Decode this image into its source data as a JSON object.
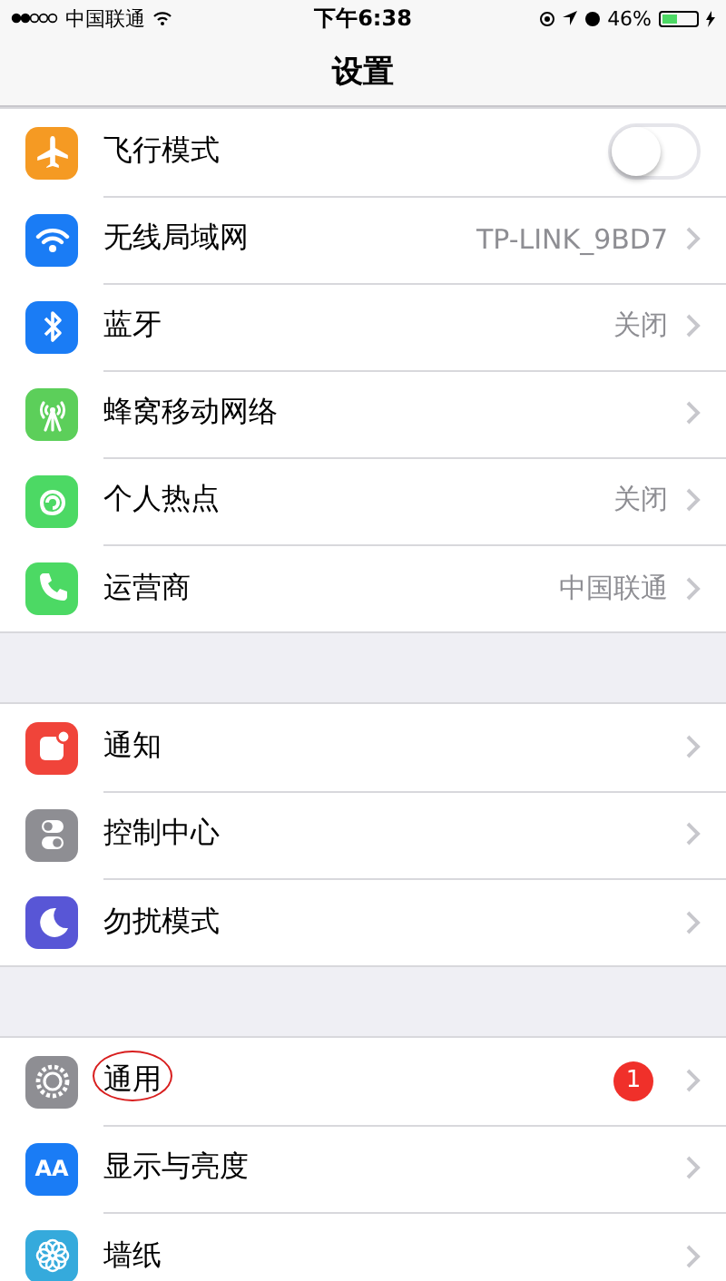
{
  "status_bar": {
    "carrier": "中国联通",
    "time": "下午6:38",
    "battery": {
      "text": "46%",
      "level": 0.46
    }
  },
  "nav": {
    "title": "设置"
  },
  "groups": [
    {
      "rows": [
        {
          "kind": "toggle",
          "label": "飞行模式",
          "on": false,
          "color": "#f59a23",
          "circled": false
        },
        {
          "kind": "link",
          "label": "无线局域网",
          "value": "TP-LINK_9BD7",
          "color": "#1a7cf5",
          "circled": false
        },
        {
          "kind": "link",
          "label": "蓝牙",
          "value": "关闭",
          "color": "#1a7cf5",
          "circled": false
        },
        {
          "kind": "link",
          "label": "蜂窝移动网络",
          "color": "#5ccf5a",
          "circled": false
        },
        {
          "kind": "link",
          "label": "个人热点",
          "value": "关闭",
          "color": "#4cd964",
          "circled": false
        },
        {
          "kind": "link",
          "label": "运营商",
          "value": "中国联通",
          "color": "#4cd964",
          "circled": false
        }
      ]
    },
    {
      "rows": [
        {
          "kind": "link",
          "label": "通知",
          "color": "#f0443a",
          "circled": false
        },
        {
          "kind": "link",
          "label": "控制中心",
          "color": "#8e8e93",
          "circled": false
        },
        {
          "kind": "link",
          "label": "勿扰模式",
          "color": "#5856d6",
          "circled": false
        }
      ]
    },
    {
      "rows": [
        {
          "kind": "link",
          "label": "通用",
          "badge": "1",
          "color": "#8e8e93",
          "circled": true
        },
        {
          "kind": "link",
          "label": "显示与亮度",
          "icon_label": "AA",
          "color": "#1a7cf5",
          "circled": false
        },
        {
          "kind": "link",
          "label": "墙纸",
          "color": "#35aadc",
          "circled": false
        }
      ]
    }
  ]
}
